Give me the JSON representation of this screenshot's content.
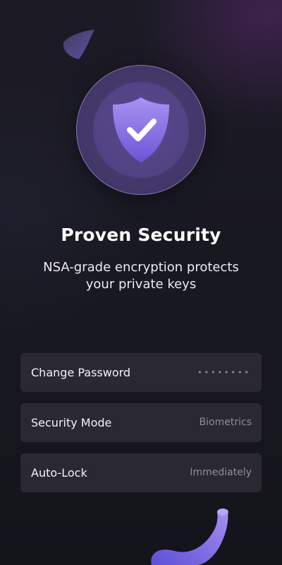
{
  "hero": {
    "icon": "shield-check-icon",
    "title": "Proven Security",
    "subtitle": "NSA-grade encryption protects your private keys"
  },
  "settings": [
    {
      "label": "Change Password",
      "value": "••••••••"
    },
    {
      "label": "Security Mode",
      "value": "Biometrics"
    },
    {
      "label": "Auto-Lock",
      "value": "Immediately"
    }
  ],
  "colors": {
    "background": "#18171f",
    "emblem_outer": "#43386a",
    "emblem_inner": "#514284",
    "shield_top": "#a58df0",
    "shield_bottom": "#6f57d8",
    "row_background": "#2a2933",
    "value_text": "#8e8d98"
  }
}
